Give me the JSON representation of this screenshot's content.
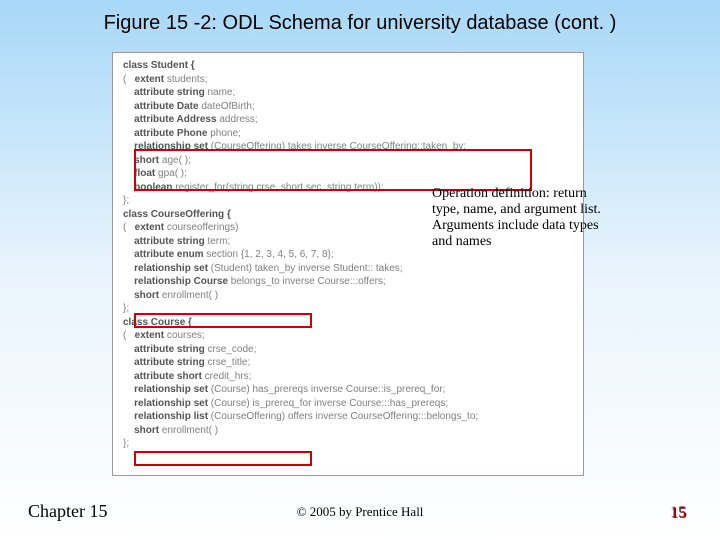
{
  "title": "Figure 15 -2: ODL Schema for university database (cont. )",
  "annotation": "Operation definition: return type, name, and argument list. Arguments include data types and names",
  "footer": {
    "left": "Chapter 15",
    "center": "© 2005 by Prentice Hall",
    "right": "15"
  },
  "code": {
    "student": {
      "header": "class Student {",
      "lines": [
        {
          "pre": "(   ",
          "kw": "extent",
          "rest": " students;"
        },
        {
          "pre": "    ",
          "kw": "attribute string",
          "rest": " name;"
        },
        {
          "pre": "    ",
          "kw": "attribute Date",
          "rest": " dateOfBirth;"
        },
        {
          "pre": "    ",
          "kw": "attribute Address",
          "rest": " address;"
        },
        {
          "pre": "    ",
          "kw": "attribute Phone",
          "rest": " phone;"
        },
        {
          "pre": "    ",
          "kw": "relationship set",
          "rest": " (CourseOffering) takes inverse CourseOffering::taken_by;"
        },
        {
          "pre": "    ",
          "kw": "short",
          "rest": " age( );"
        },
        {
          "pre": "    ",
          "kw": "float",
          "rest": " gpa( );"
        },
        {
          "pre": "    ",
          "kw": "boolean",
          "rest": " register_for(string crse, short sec, string term));"
        }
      ],
      "close": "};"
    },
    "offering": {
      "header": "class CourseOffering {",
      "lines": [
        {
          "pre": "(   ",
          "kw": "extent",
          "rest": " courseofferings)"
        },
        {
          "pre": "    ",
          "kw": "attribute string",
          "rest": " term;"
        },
        {
          "pre": "    ",
          "kw": "attribute enum",
          "rest": " section {1, 2, 3, 4, 5, 6, 7, 8};"
        },
        {
          "pre": "    ",
          "kw": "relationship set",
          "rest": " (Student) taken_by inverse Student:: takes;"
        },
        {
          "pre": "    ",
          "kw": "relationship Course",
          "rest": " belongs_to inverse Course:::offers;"
        },
        {
          "pre": "    ",
          "kw": "short",
          "rest": " enrollment( )"
        }
      ],
      "close": "};"
    },
    "course": {
      "header": "class Course {",
      "lines": [
        {
          "pre": "(   ",
          "kw": "extent",
          "rest": " courses;"
        },
        {
          "pre": "    ",
          "kw": "attribute string",
          "rest": " crse_code;"
        },
        {
          "pre": "    ",
          "kw": "attribute string",
          "rest": " crse_title;"
        },
        {
          "pre": "    ",
          "kw": "attribute short",
          "rest": " credit_hrs;"
        },
        {
          "pre": "    ",
          "kw": "relationship set",
          "rest": " (Course) has_prereqs inverse Course::is_prereq_for;"
        },
        {
          "pre": "    ",
          "kw": "relationship set",
          "rest": " (Course) is_prereq_for inverse Course:::has_prereqs;"
        },
        {
          "pre": "    ",
          "kw": "relationship list",
          "rest": " (CourseOffering) offers inverse CourseOffering:::belongs_to;"
        },
        {
          "pre": "    ",
          "kw": "short",
          "rest": " enrollment( )"
        }
      ],
      "close": "};"
    }
  }
}
